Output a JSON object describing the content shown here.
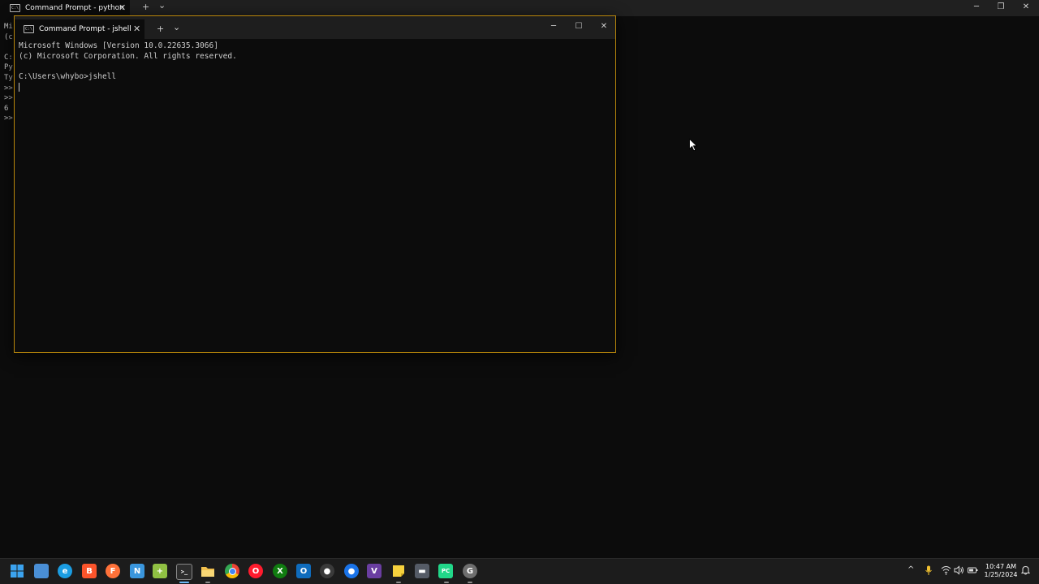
{
  "background_window": {
    "tab_title": "Command Prompt - python",
    "tab_icon_glyph": "C:\\",
    "new_tab_symbol": "+",
    "dropdown_symbol": "⌄",
    "minimize_symbol": "─",
    "maximize_symbol": "❐",
    "close_symbol": "✕",
    "visible_lines": [
      "Mi",
      "(c",
      "",
      "C:",
      "Py",
      "Ty",
      ">>",
      ">>",
      "6",
      ">>"
    ]
  },
  "foreground_window": {
    "tab_title": "Command Prompt - jshell",
    "tab_icon_glyph": "C:\\",
    "tab_close_symbol": "✕",
    "new_tab_symbol": "+",
    "dropdown_symbol": "⌄",
    "minimize_symbol": "─",
    "maximize_symbol": "☐",
    "close_symbol": "✕",
    "lines": [
      "Microsoft Windows [Version 10.0.22635.3066]",
      "(c) Microsoft Corporation. All rights reserved.",
      "",
      "C:\\Users\\whybo>jshell"
    ]
  },
  "taskbar": {
    "apps": [
      {
        "name": "start",
        "icon": "windows-logo-icon",
        "color": "#2b88d8"
      },
      {
        "name": "widgets",
        "icon": "widgets-icon",
        "color": "#4a8fd6"
      },
      {
        "name": "edge",
        "icon": "edge-icon",
        "color": "#1b9de2"
      },
      {
        "name": "brave",
        "icon": "brave-icon",
        "color": "#fb542b"
      },
      {
        "name": "firefox",
        "icon": "firefox-icon",
        "color": "#ff7139"
      },
      {
        "name": "notepad",
        "icon": "notepad-icon",
        "color": "#3a96dd"
      },
      {
        "name": "notepad-plus",
        "icon": "notepad-plus-icon",
        "color": "#90c043"
      },
      {
        "name": "terminal",
        "icon": "terminal-icon",
        "color": "#2d2d2d"
      },
      {
        "name": "file-explorer",
        "icon": "folder-icon",
        "color": "#f2c14e"
      },
      {
        "name": "chrome",
        "icon": "chrome-icon",
        "color": "#34a853"
      },
      {
        "name": "opera",
        "icon": "opera-icon",
        "color": "#ff1b2d"
      },
      {
        "name": "xbox",
        "icon": "xbox-icon",
        "color": "#107c10"
      },
      {
        "name": "outlook",
        "icon": "outlook-icon",
        "color": "#0f6cbd"
      },
      {
        "name": "obs",
        "icon": "recorder-icon",
        "color": "#3a3a3a"
      },
      {
        "name": "messenger",
        "icon": "chat-bubble-icon",
        "color": "#1a73e8"
      },
      {
        "name": "visual-studio",
        "icon": "visual-studio-icon",
        "color": "#6a3ea1"
      },
      {
        "name": "sticky-notes",
        "icon": "sticky-note-icon",
        "color": "#f7d13d"
      },
      {
        "name": "app-tile",
        "icon": "app-tile-icon",
        "color": "#555b66"
      },
      {
        "name": "pycharm",
        "icon": "pycharm-icon",
        "color": "#21d789"
      },
      {
        "name": "github-desktop",
        "icon": "github-icon",
        "color": "#6e6e6e"
      }
    ],
    "tray": {
      "chevron": "^",
      "mic": "mic-icon",
      "wifi": "wifi-icon",
      "volume": "speaker-icon",
      "battery": "battery-icon"
    },
    "clock_time": "10:47 AM",
    "clock_date": "1/25/2024"
  },
  "colors": {
    "terminal_bg": "#0c0c0c",
    "terminal_text": "#cccccc",
    "window_border_accent": "#b8860b",
    "taskbar_bg": "#1c1c1c"
  }
}
